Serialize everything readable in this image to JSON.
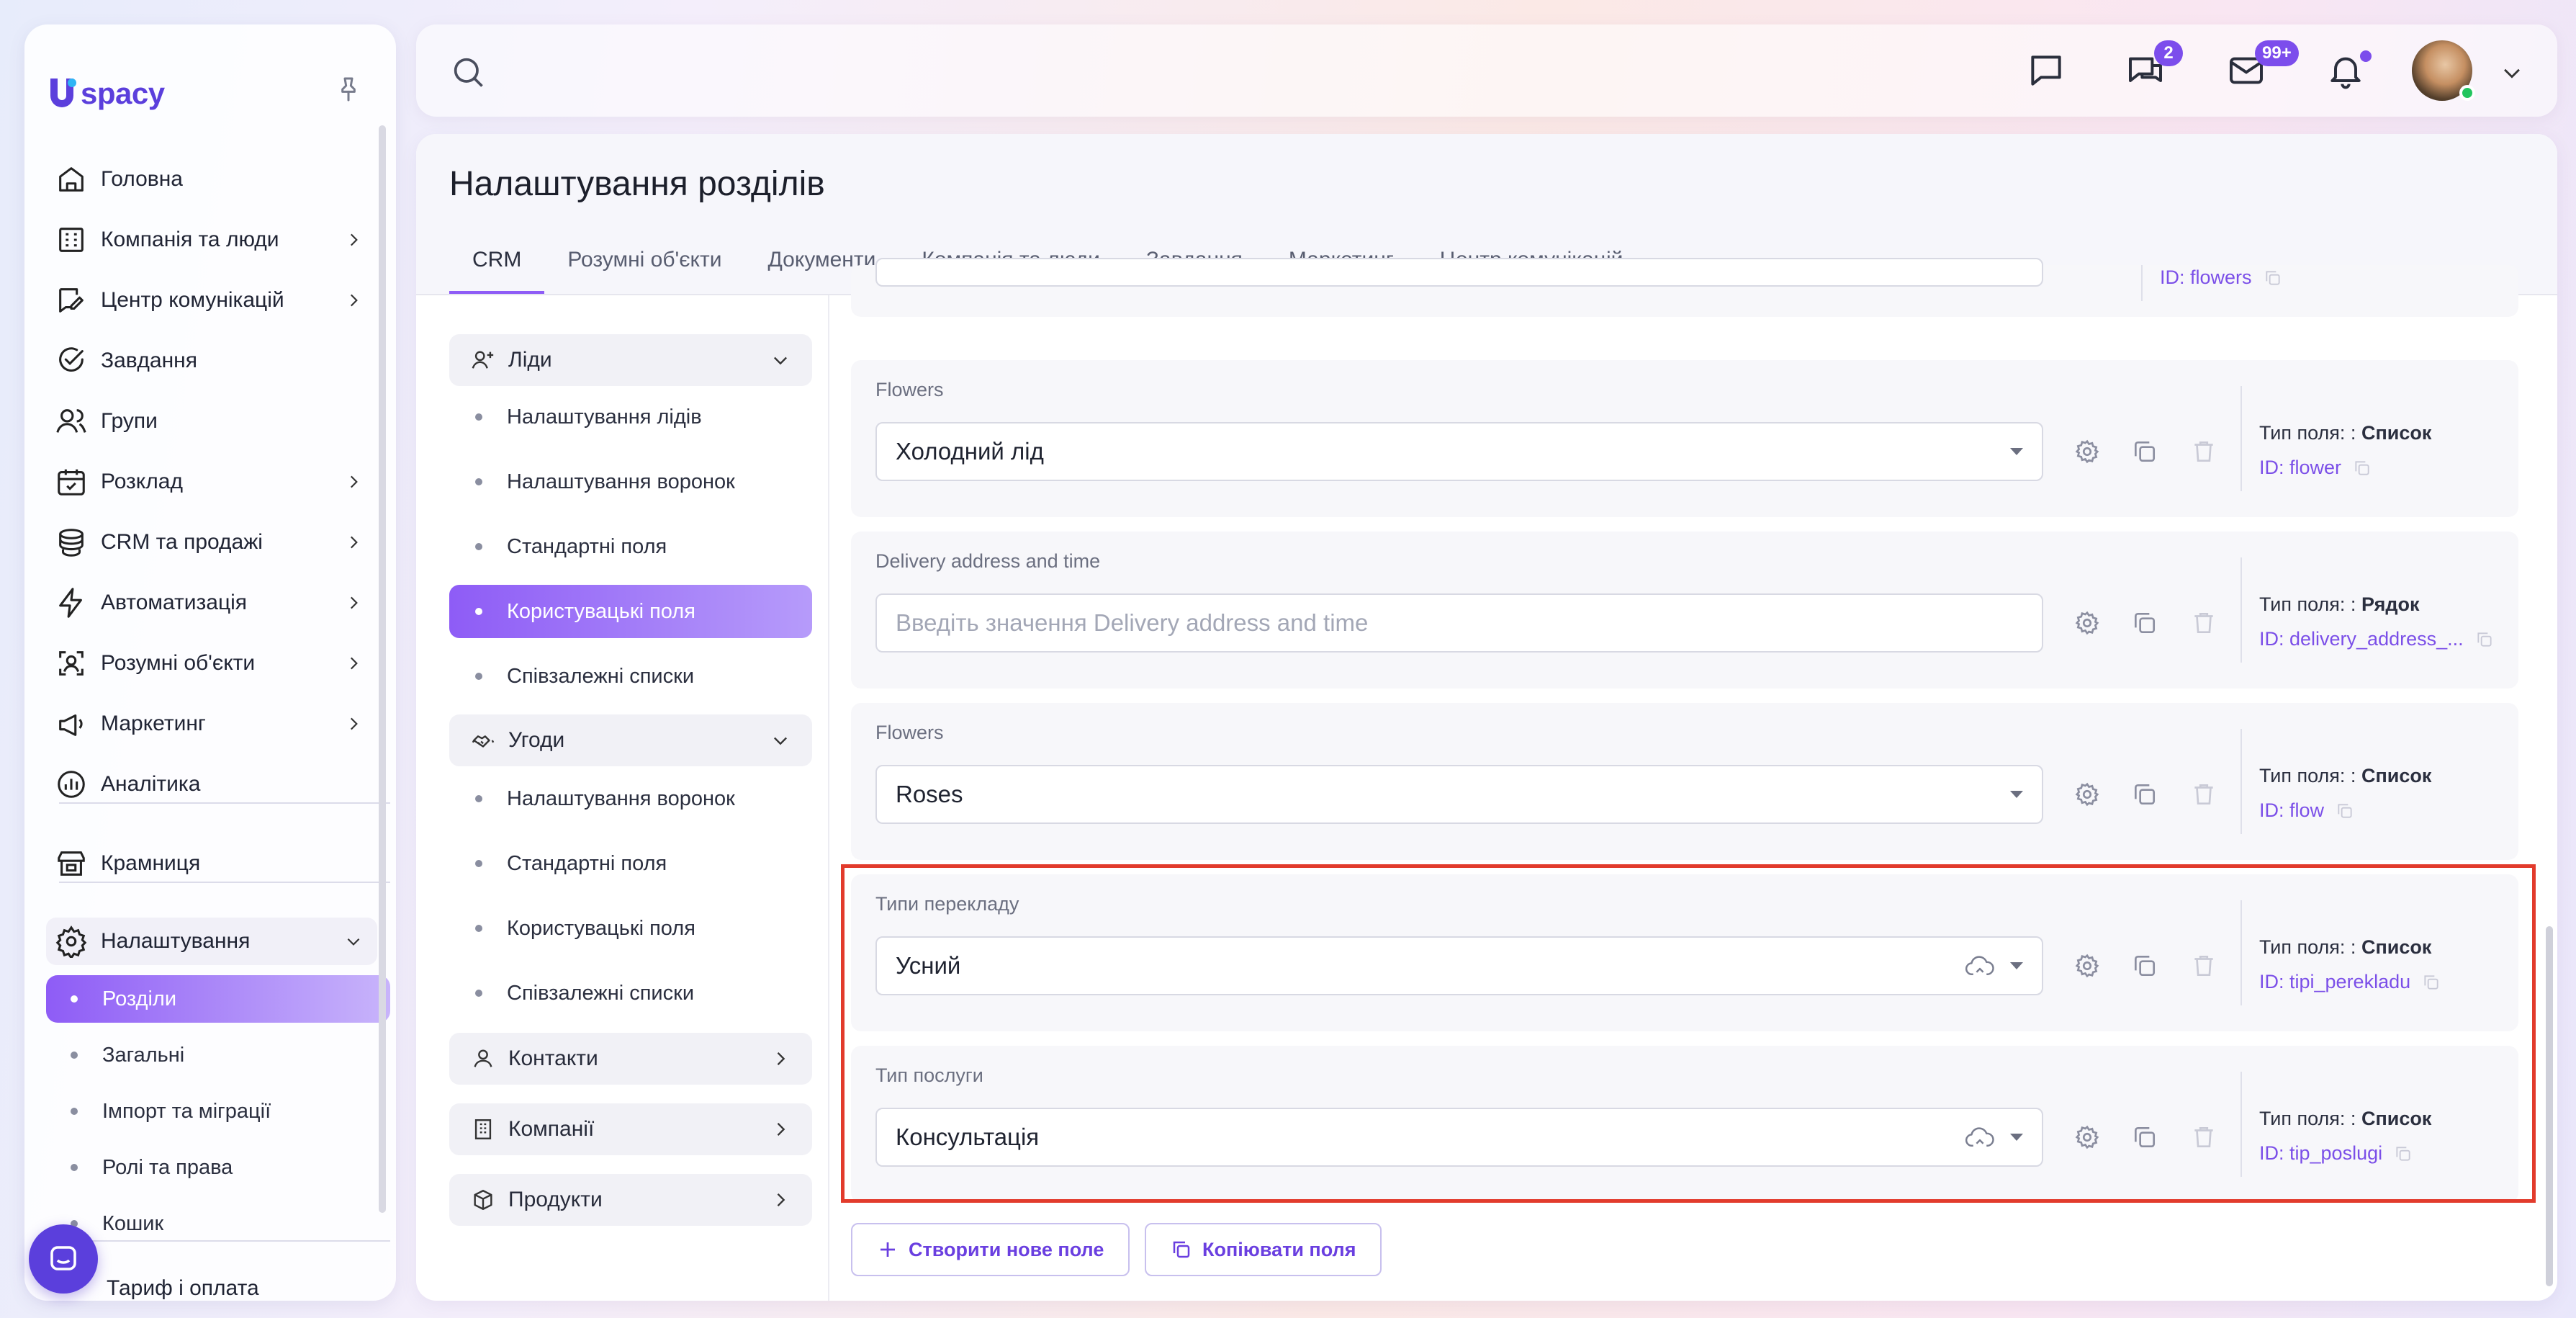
{
  "brand": {
    "name": "spacy",
    "accent": "#8e5cf6",
    "logo_color": "#5b3fdc"
  },
  "sidebar": {
    "items": [
      {
        "label": "Головна",
        "icon": "home-icon",
        "has_arrow": false
      },
      {
        "label": "Компанія та люди",
        "icon": "building-icon",
        "has_arrow": true
      },
      {
        "label": "Центр комунікацій",
        "icon": "chat-edit-icon",
        "has_arrow": true
      },
      {
        "label": "Завдання",
        "icon": "check-circle-icon",
        "has_arrow": false
      },
      {
        "label": "Групи",
        "icon": "users-icon",
        "has_arrow": false
      },
      {
        "label": "Розклад",
        "icon": "calendar-icon",
        "has_arrow": true
      },
      {
        "label": "CRM та продажі",
        "icon": "database-icon",
        "has_arrow": true
      },
      {
        "label": "Автоматизація",
        "icon": "lightning-icon",
        "has_arrow": true
      },
      {
        "label": "Розумні об'єкти",
        "icon": "smart-object-icon",
        "has_arrow": true
      },
      {
        "label": "Маркетинг",
        "icon": "megaphone-icon",
        "has_arrow": true
      },
      {
        "label": "Аналітика",
        "icon": "analytics-icon",
        "has_arrow": false
      }
    ],
    "store": "Крамниця",
    "settings": "Налаштування",
    "settings_sub": [
      "Розділи",
      "Загальні",
      "Імпорт та міграції",
      "Ролі та права",
      "Кошик"
    ],
    "tariff": "Тариф і оплата"
  },
  "topbar": {
    "chat_badge": "2",
    "mail_badge": "99+"
  },
  "main": {
    "title": "Налаштування розділів",
    "tabs": [
      "CRM",
      "Розумні об'єкти",
      "Документи",
      "Компанія та люди",
      "Завдання",
      "Маркетинг",
      "Центр комунікацій"
    ],
    "left_menu": {
      "leads": "Ліди",
      "leads_items": [
        "Налаштування лідів",
        "Налаштування воронок",
        "Стандартні поля",
        "Користувацькі поля",
        "Співзалежні списки"
      ],
      "deals": "Угоди",
      "deals_items": [
        "Налаштування воронок",
        "Стандартні поля",
        "Користувацькі поля",
        "Співзалежні списки"
      ],
      "contacts": "Контакти",
      "companies": "Компанії",
      "products": "Продукти"
    },
    "partial_top_id": "ID: flowers",
    "fields": [
      {
        "label": "Flowers",
        "value": "Холодний лід",
        "placeholder": "",
        "type_prefix": "Тип поля: :",
        "type": "Список",
        "id": "ID: flower",
        "dropdown": true,
        "cloud": false
      },
      {
        "label": "Delivery address and time",
        "value": "",
        "placeholder": "Введіть значення Delivery address and time",
        "type_prefix": "Тип поля: :",
        "type": "Рядок",
        "id": "ID: delivery_address_...",
        "dropdown": false,
        "cloud": false
      },
      {
        "label": "Flowers",
        "value": "Roses",
        "placeholder": "",
        "type_prefix": "Тип поля: :",
        "type": "Список",
        "id": "ID: flow",
        "dropdown": true,
        "cloud": false
      },
      {
        "label": "Типи перекладу",
        "value": "Усний",
        "placeholder": "",
        "type_prefix": "Тип поля: :",
        "type": "Список",
        "id": "ID: tipi_perekladu",
        "dropdown": true,
        "cloud": true
      },
      {
        "label": "Тип послуги",
        "value": "Консультація",
        "placeholder": "",
        "type_prefix": "Тип поля: :",
        "type": "Список",
        "id": "ID: tip_poslugi",
        "dropdown": true,
        "cloud": true
      }
    ],
    "buttons": {
      "create": "Створити нове поле",
      "copy": "Копіювати поля"
    }
  }
}
